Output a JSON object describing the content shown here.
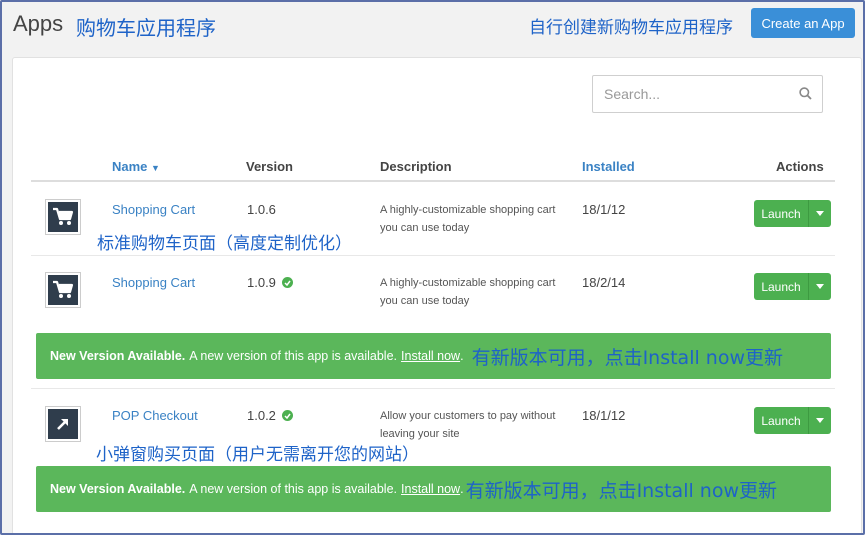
{
  "header": {
    "title": "Apps",
    "annotation": "购物车应用程序",
    "create_annotation": "自行创建新购物车应用程序",
    "create_button": "Create an App"
  },
  "search": {
    "placeholder": "Search..."
  },
  "table": {
    "columns": {
      "name": "Name",
      "version": "Version",
      "description": "Description",
      "installed": "Installed",
      "actions": "Actions"
    },
    "rows": [
      {
        "icon": "cart-icon",
        "name": "Shopping Cart",
        "version": "1.0.6",
        "description": "A highly-customizable shopping cart you can use today",
        "installed": "18/1/12",
        "action": "Launch",
        "annotation": "标准购物车页面（高度定制优化）"
      },
      {
        "icon": "cart-icon",
        "name": "Shopping Cart",
        "version": "1.0.9",
        "description": "A highly-customizable shopping cart you can use today",
        "installed": "18/2/14",
        "action": "Launch",
        "update_available": true
      },
      {
        "icon": "external-arrow-icon",
        "name": "POP Checkout",
        "version": "1.0.2",
        "description": "Allow your customers to pay without leaving your site",
        "installed": "18/1/12",
        "action": "Launch",
        "update_available": true,
        "annotation": "小弹窗购买页面（用户无需离开您的网站）"
      }
    ]
  },
  "banners": [
    {
      "strong": "New Version Available.",
      "text": "A new version of this app is available.",
      "link": "Install now",
      "dot": ".",
      "annotation": "有新版本可用，点击Install now更新"
    },
    {
      "strong": "New Version Available.",
      "text": "A new version of this app is available.",
      "link": "Install now",
      "dot": ".",
      "annotation": "有新版本可用，点击Install now更新"
    }
  ],
  "colors": {
    "primary": "#3a8fd8",
    "success": "#4cb050",
    "banner": "#5bb75b",
    "annotation": "#1e63c8",
    "icon_bg": "#2f3d4c"
  }
}
